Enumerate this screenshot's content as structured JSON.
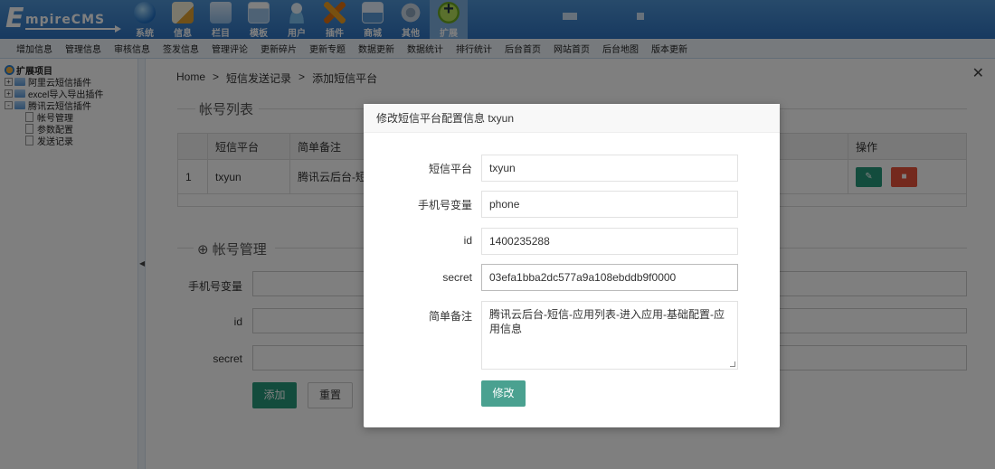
{
  "header": {
    "logo_text": "EmpireCMS",
    "logo_initial": "E",
    "logo_rest": "mpireCMS",
    "nav": [
      {
        "label": "系统",
        "icon": "globe-icon"
      },
      {
        "label": "信息",
        "icon": "pencil-icon"
      },
      {
        "label": "栏目",
        "icon": "folder-icon"
      },
      {
        "label": "模板",
        "icon": "template-icon"
      },
      {
        "label": "用户",
        "icon": "user-icon"
      },
      {
        "label": "插件",
        "icon": "plugin-icon"
      },
      {
        "label": "商城",
        "icon": "shop-icon"
      },
      {
        "label": "其他",
        "icon": "gear-icon"
      },
      {
        "label": "扩展",
        "icon": "plus-icon",
        "active": true
      }
    ]
  },
  "submenu": [
    "增加信息",
    "管理信息",
    "审核信息",
    "签发信息",
    "管理评论",
    "更新碎片",
    "更新专题",
    "数据更新",
    "数据统计",
    "排行统计",
    "后台首页",
    "网站首页",
    "后台地图",
    "版本更新"
  ],
  "tree": {
    "root": "扩展项目",
    "items": [
      {
        "label": "阿里云短信插件",
        "toggle": "+"
      },
      {
        "label": "excel导入导出插件",
        "toggle": "+"
      },
      {
        "label": "腾讯云短信插件",
        "toggle": "-"
      }
    ],
    "children": [
      "帐号管理",
      "参数配置",
      "发送记录"
    ]
  },
  "main": {
    "breadcrumb": [
      "Home",
      ">",
      "短信发送记录",
      ">",
      "添加短信平台"
    ],
    "list_title": "帐号列表",
    "table": {
      "headers": [
        "",
        "短信平台",
        "简单备注",
        "操作"
      ],
      "rows": [
        {
          "index": "1",
          "platform": "txyun",
          "note": "腾讯云后台-短信"
        }
      ]
    },
    "manage_title": "帐号管理",
    "form": {
      "phone_label": "手机号变量",
      "id_label": "id",
      "secret_label": "secret",
      "add_label": "添加",
      "reset_label": "重置"
    }
  },
  "modal": {
    "title": "修改短信平台配置信息 txyun",
    "fields": {
      "platform_label": "短信平台",
      "platform_value": "txyun",
      "phone_label": "手机号变量",
      "phone_value": "phone",
      "id_label": "id",
      "id_value": "1400235288",
      "secret_label": "secret",
      "secret_value": "03efa1bba2dc577a9a108ebddb9f0000",
      "note_label": "简单备注",
      "note_value": "腾讯云后台-短信-应用列表-进入应用-基础配置-应用信息"
    },
    "submit_label": "修改"
  }
}
